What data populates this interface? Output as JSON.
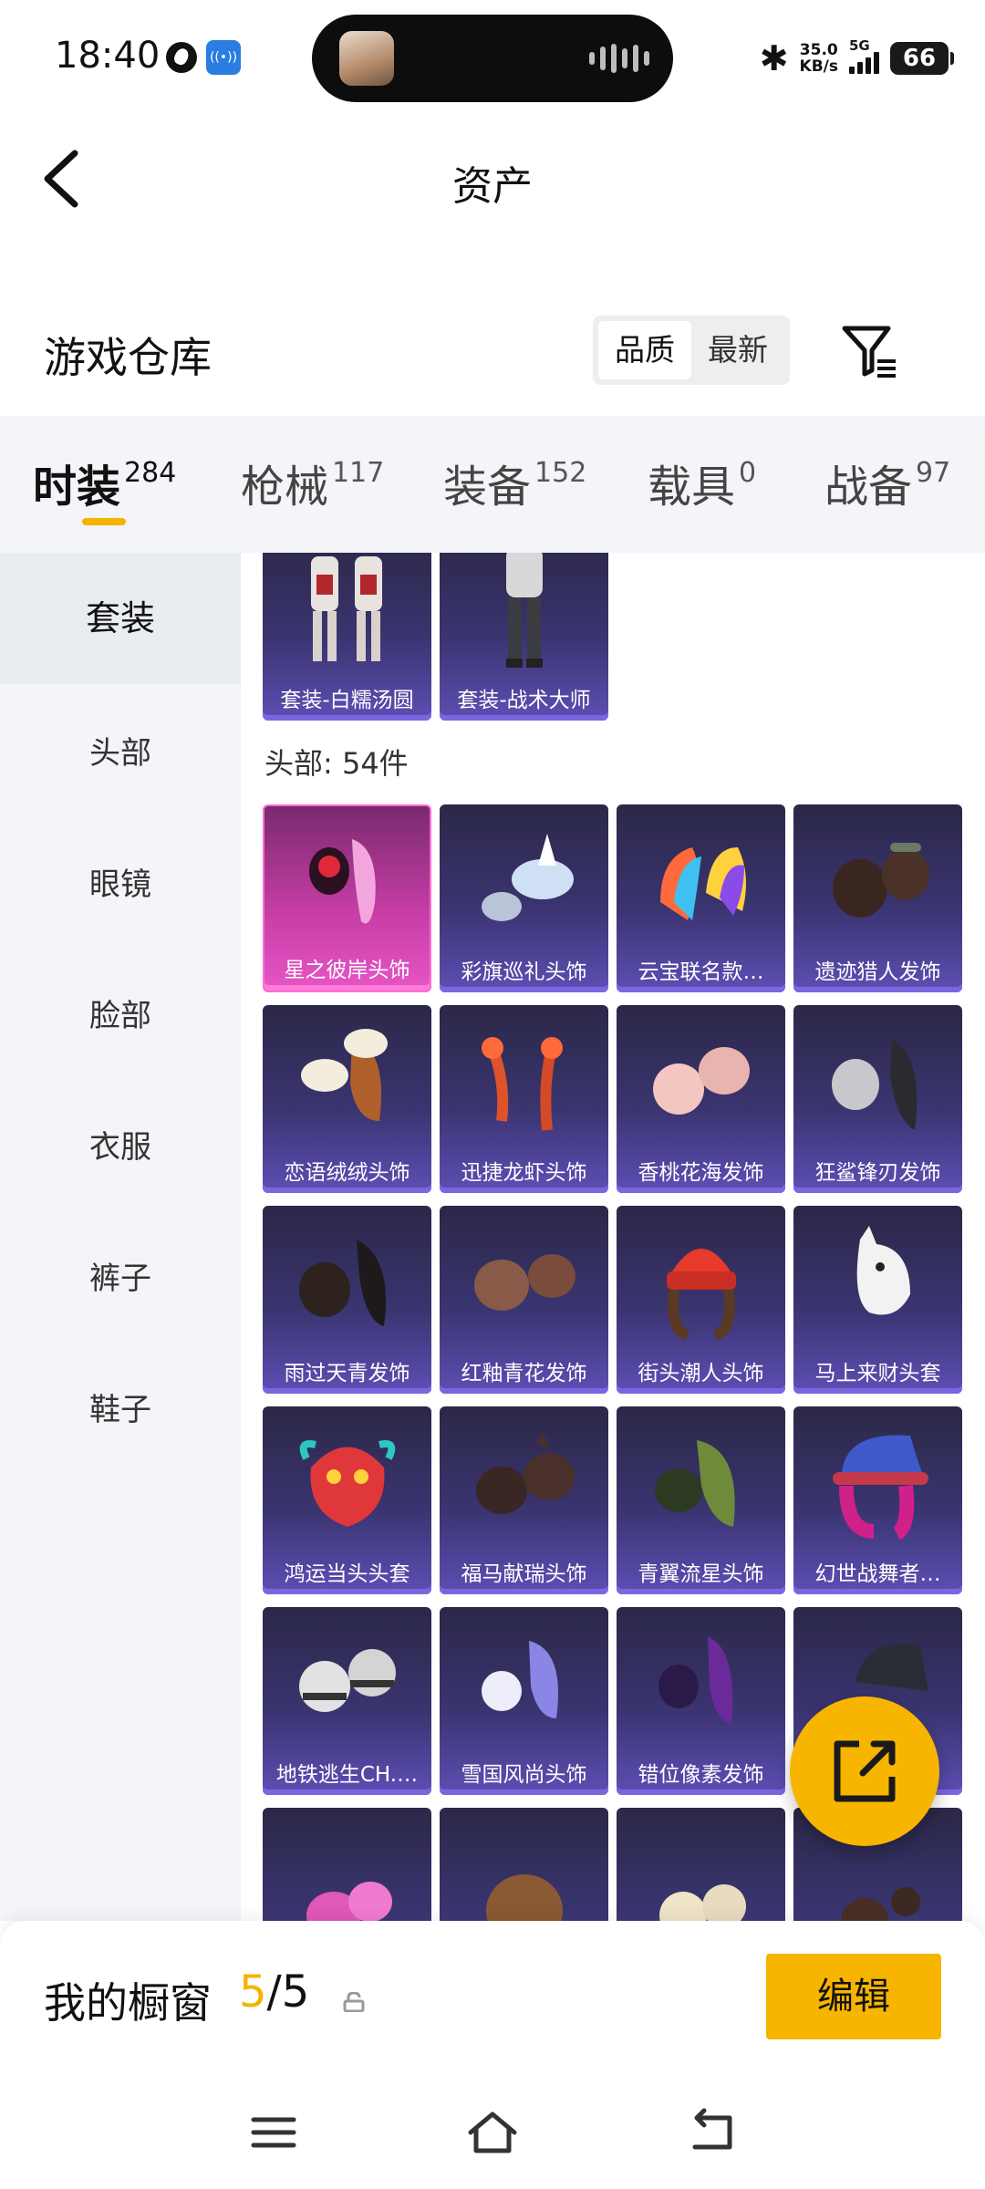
{
  "status": {
    "time": "18:40",
    "net_speed_value": "35.0",
    "net_speed_unit": "KB/s",
    "network": "5G",
    "battery": "66"
  },
  "header": {
    "title": "资产"
  },
  "warehouse": {
    "title": "游戏仓库",
    "sort_options": [
      "品质",
      "最新"
    ],
    "active_sort": "品质"
  },
  "tabs": [
    {
      "label": "时装",
      "count": "284",
      "active": true
    },
    {
      "label": "枪械",
      "count": "117"
    },
    {
      "label": "装备",
      "count": "152"
    },
    {
      "label": "载具",
      "count": "0"
    },
    {
      "label": "战备",
      "count": "97"
    }
  ],
  "side_menu": [
    {
      "label": "套装",
      "active": true
    },
    {
      "label": "头部"
    },
    {
      "label": "眼镜"
    },
    {
      "label": "脸部"
    },
    {
      "label": "衣服"
    },
    {
      "label": "裤子"
    },
    {
      "label": "鞋子"
    }
  ],
  "suits": [
    {
      "label": "套装-白糯汤圆"
    },
    {
      "label": "套装-战术大师"
    }
  ],
  "head_group": {
    "label": "头部: 54件",
    "items": [
      {
        "label": "星之彼岸头饰",
        "rarity": "legend"
      },
      {
        "label": "彩旗巡礼头饰"
      },
      {
        "label": "云宝联名款…"
      },
      {
        "label": "遗迹猎人发饰"
      },
      {
        "label": "恋语绒绒头饰"
      },
      {
        "label": "迅捷龙虾头饰"
      },
      {
        "label": "香桃花海发饰"
      },
      {
        "label": "狂鲨锋刃发饰"
      },
      {
        "label": "雨过天青发饰"
      },
      {
        "label": "红釉青花发饰"
      },
      {
        "label": "街头潮人头饰"
      },
      {
        "label": "马上来财头套"
      },
      {
        "label": "鸿运当头头套"
      },
      {
        "label": "福马献瑞头饰"
      },
      {
        "label": "青翼流星头饰"
      },
      {
        "label": "幻世战舞者…"
      },
      {
        "label": "地铁逃生CH.…"
      },
      {
        "label": "雪国风尚头饰"
      },
      {
        "label": "错位像素发饰"
      },
      {
        "label": ""
      }
    ]
  },
  "showcase": {
    "label": "我的橱窗",
    "current": "5",
    "separator": "/",
    "total": "5",
    "edit_label": "编辑"
  },
  "colors": {
    "accent": "#f7b500",
    "card_purple": "#3a3470",
    "card_legend": "#c93ea8"
  }
}
